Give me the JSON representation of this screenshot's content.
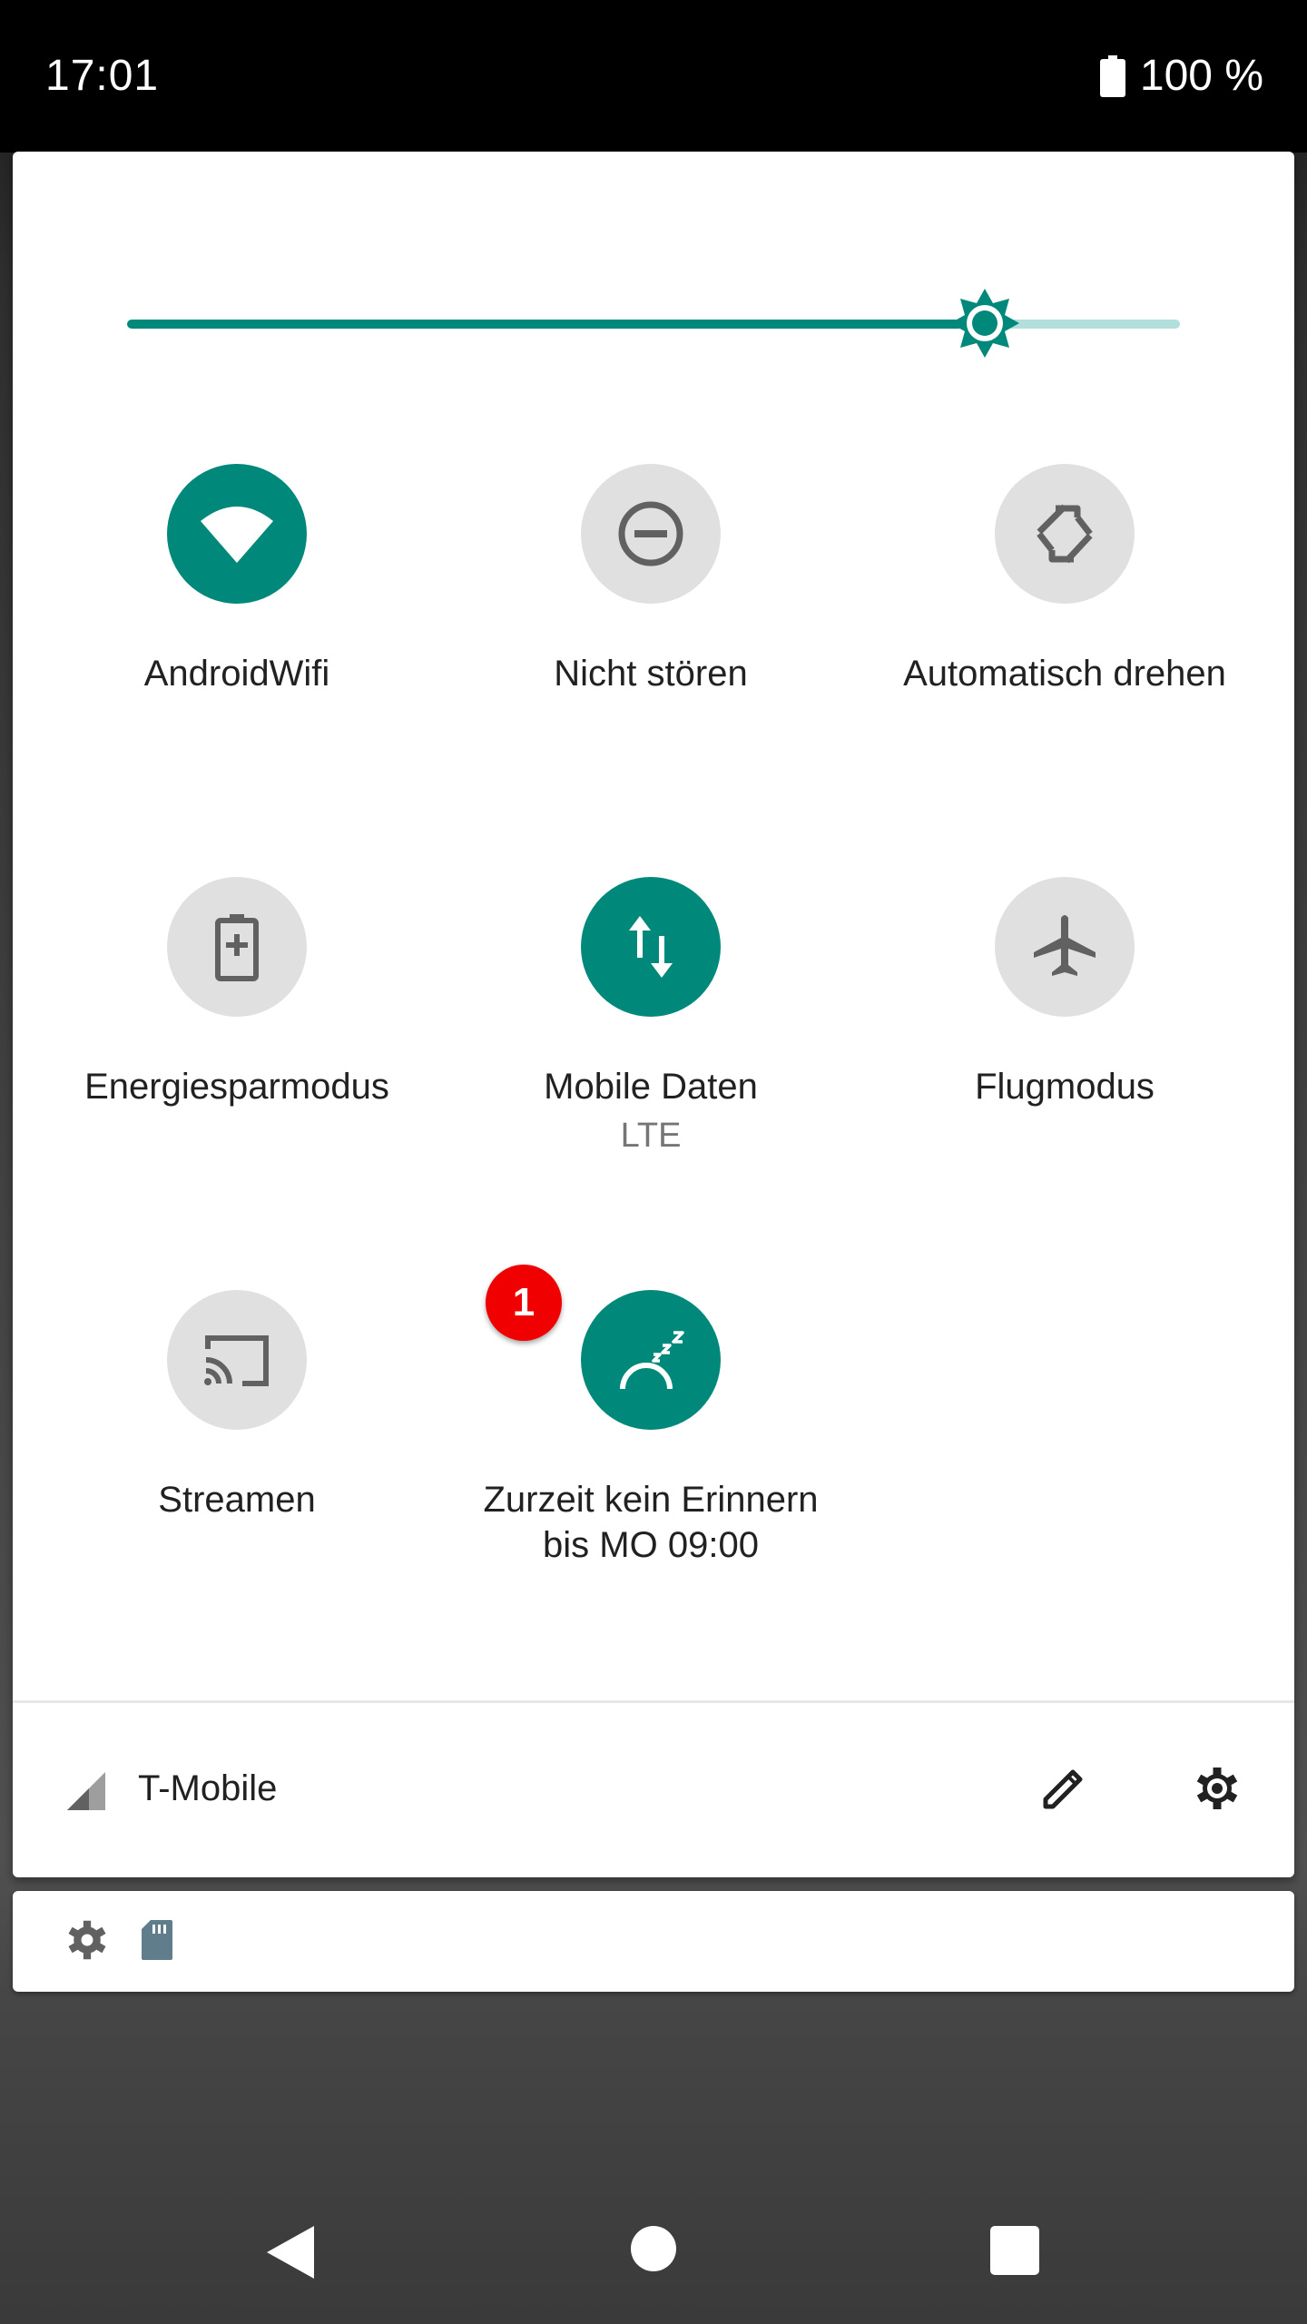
{
  "status_bar": {
    "time": "17:01",
    "battery": "100 %"
  },
  "brightness": {
    "level": 0.815
  },
  "tiles": [
    {
      "label": "AndroidWifi",
      "icon": "wifi-icon",
      "active": true
    },
    {
      "label": "Nicht stören",
      "icon": "do-not-disturb-icon",
      "active": false
    },
    {
      "label": "Automatisch drehen",
      "icon": "auto-rotate-icon",
      "active": false
    },
    {
      "label": "Energiesparmodus",
      "icon": "battery-saver-icon",
      "active": false
    },
    {
      "label": "Mobile Daten",
      "sublabel": "LTE",
      "icon": "mobile-data-icon",
      "active": true
    },
    {
      "label": "Flugmodus",
      "icon": "airplane-icon",
      "active": false
    },
    {
      "label": "Streamen",
      "icon": "cast-icon",
      "active": false
    },
    {
      "label": "Zurzeit kein Erinnern bis MO 09:00",
      "icon": "sleep-snooze-icon",
      "active": true,
      "badge": "1"
    }
  ],
  "footer": {
    "carrier": "T-Mobile",
    "edit_icon": "pencil-icon",
    "settings_icon": "gear-icon"
  },
  "notification": {
    "icons": [
      "gear-icon",
      "sd-card-icon"
    ]
  },
  "colors": {
    "accent": "#00897b",
    "accent_light": "#b2dfdb",
    "tile_off": "#e0e0e0",
    "badge": "#f10000"
  },
  "nav": {
    "back_icon": "back-triangle-icon",
    "home_icon": "home-circle-icon",
    "recents_icon": "recents-square-icon"
  }
}
